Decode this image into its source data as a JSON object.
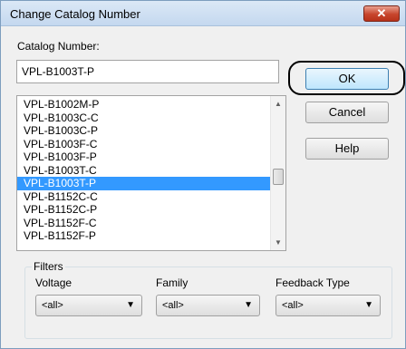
{
  "window": {
    "title": "Change Catalog Number",
    "close_glyph": "✕"
  },
  "catalog": {
    "label": "Catalog Number:",
    "value": "VPL-B1003T-P"
  },
  "buttons": {
    "ok": "OK",
    "cancel": "Cancel",
    "help": "Help"
  },
  "list": {
    "items": [
      "VPL-B1002M-P",
      "VPL-B1003C-C",
      "VPL-B1003C-P",
      "VPL-B1003F-C",
      "VPL-B1003F-P",
      "VPL-B1003T-C",
      "VPL-B1003T-P",
      "VPL-B1152C-C",
      "VPL-B1152C-P",
      "VPL-B1152F-C",
      "VPL-B1152F-P"
    ],
    "selected_index": 6,
    "scroll_up_glyph": "▲",
    "scroll_down_glyph": "▼"
  },
  "filters": {
    "legend": "Filters",
    "voltage": {
      "label": "Voltage",
      "value": "<all>"
    },
    "family": {
      "label": "Family",
      "value": "<all>"
    },
    "feedback": {
      "label": "Feedback Type",
      "value": "<all>"
    },
    "caret_glyph": "▼"
  },
  "colors": {
    "selection": "#3399ff",
    "title_bar": "#c4d8ef",
    "close": "#c7452c"
  },
  "icons": {
    "close": "close-icon",
    "dropdown": "chevron-down-icon"
  }
}
